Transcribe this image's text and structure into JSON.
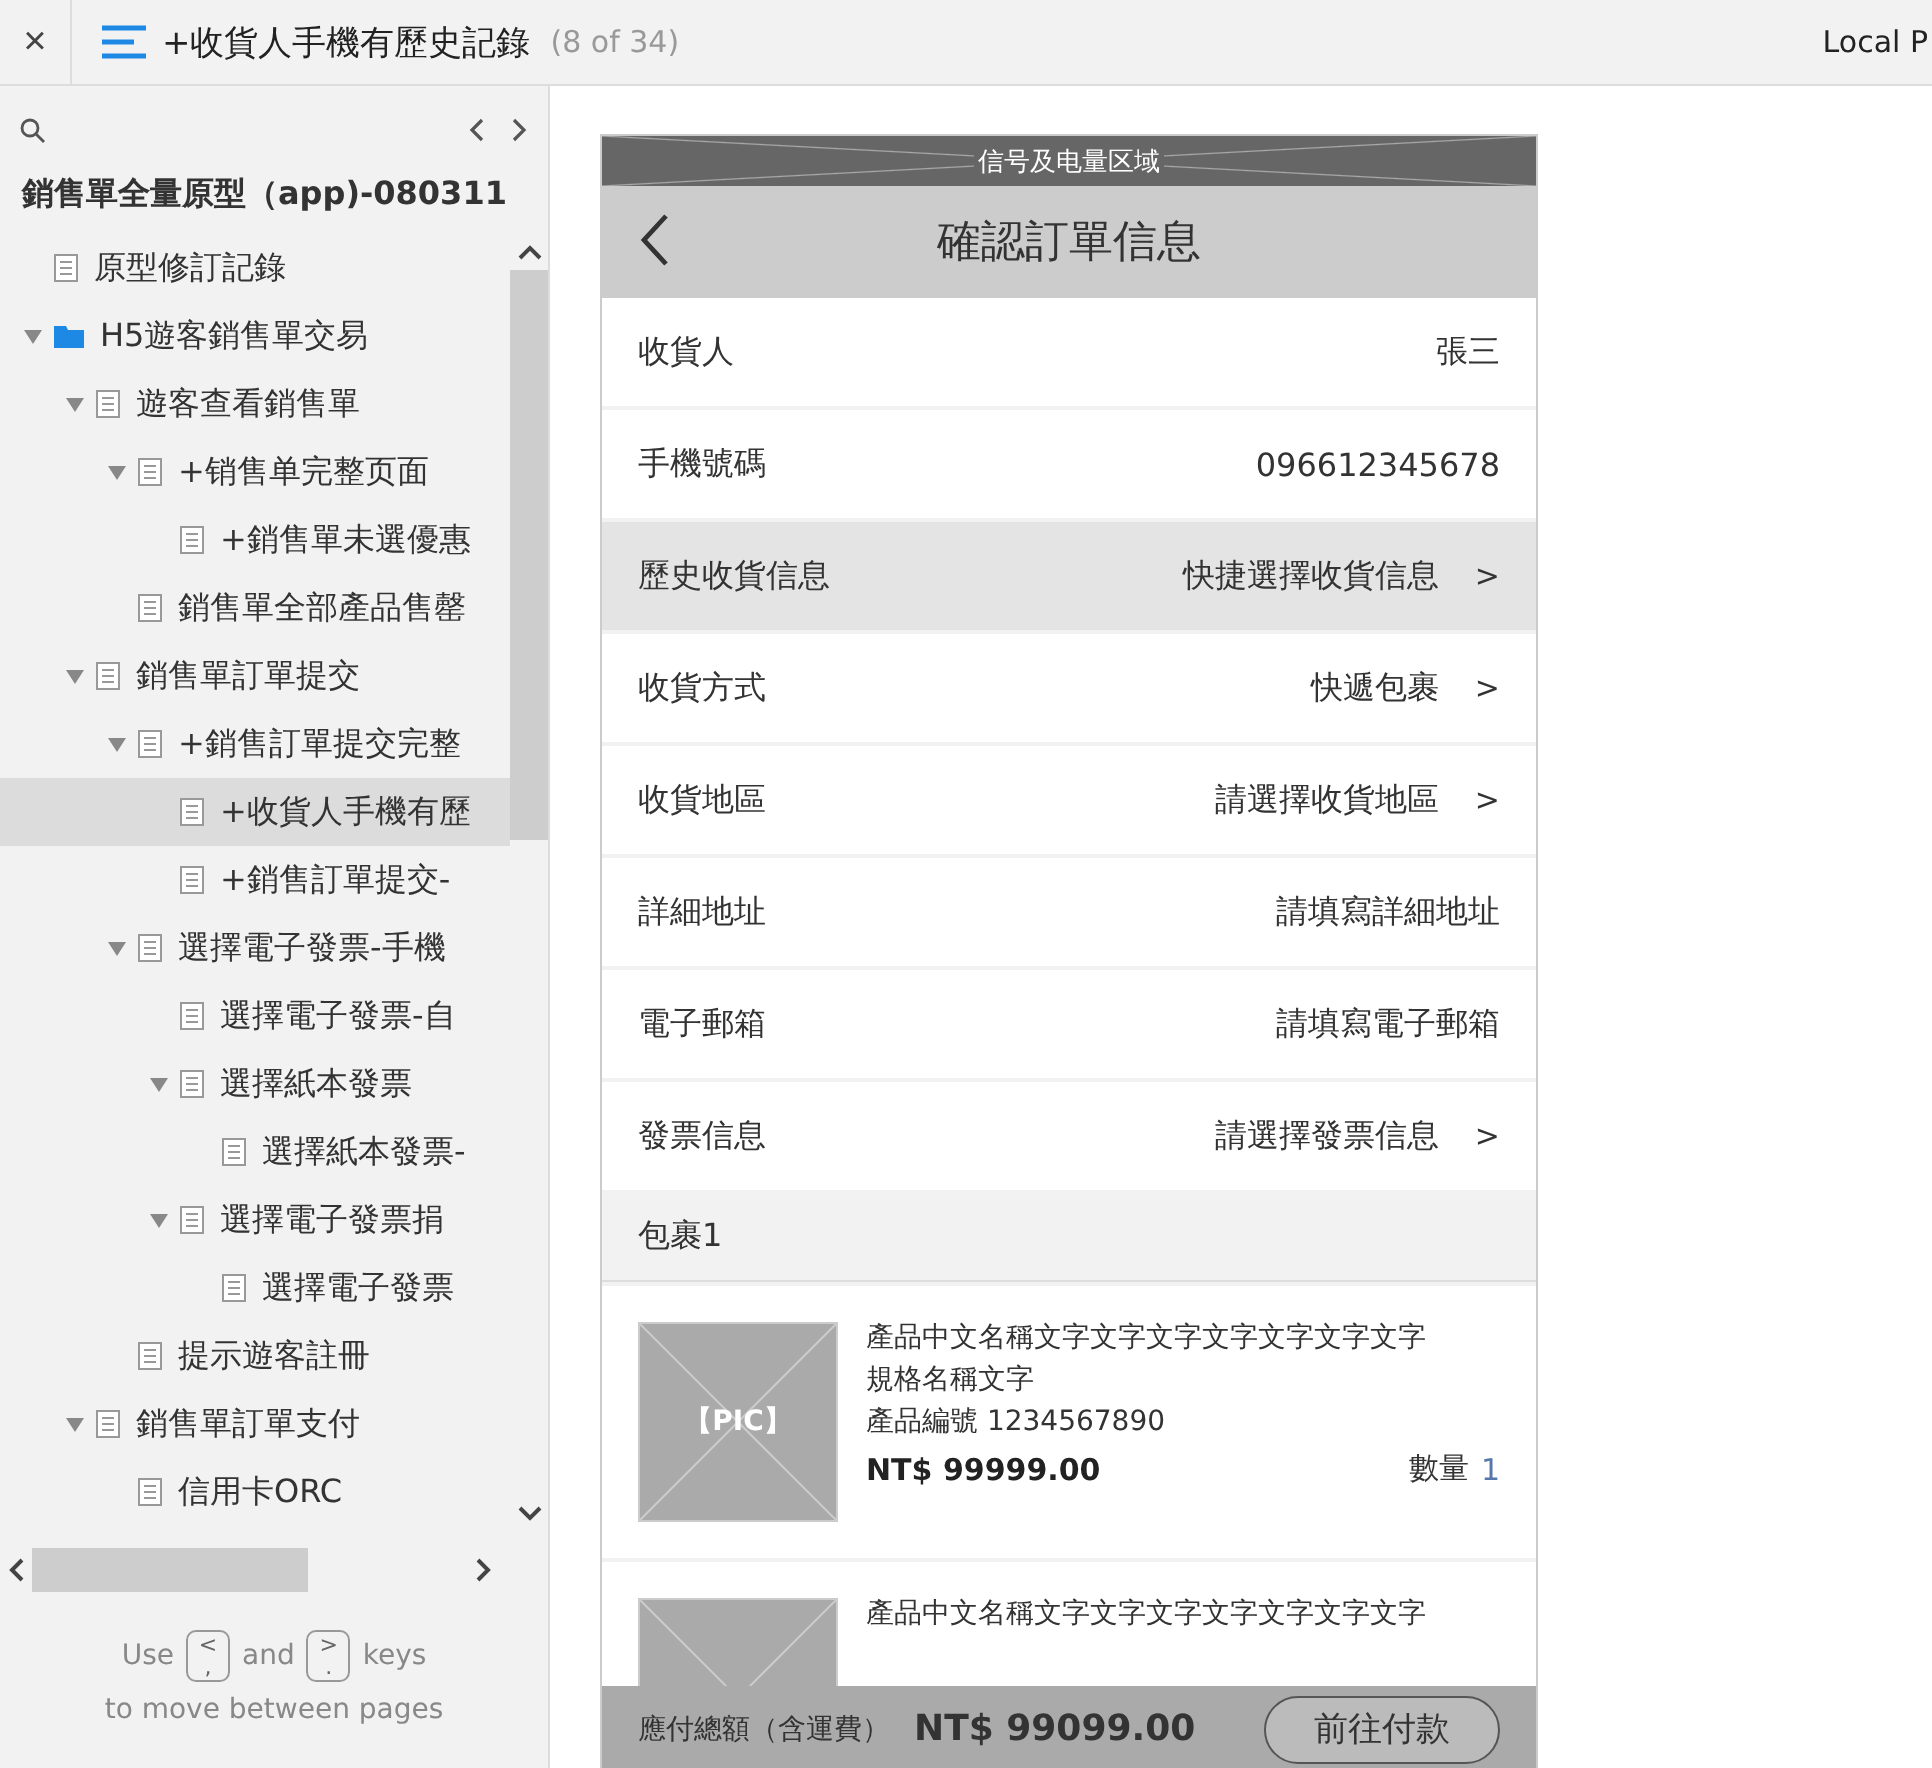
{
  "top_bar": {
    "close": "×",
    "title": "+收貨人手機有歷史記錄",
    "page_count": "(8 of 34)",
    "right_label": "Local P"
  },
  "sidebar": {
    "project_title": "銷售單全量原型（app)-080311",
    "tree": [
      {
        "label": "原型修訂記錄",
        "kind": "page",
        "selected": false
      },
      {
        "label": "H5遊客銷售單交易",
        "kind": "folder",
        "selected": false,
        "expanded": true,
        "children": [
          {
            "label": "遊客查看銷售單",
            "kind": "page",
            "selected": false,
            "expanded": true,
            "children": [
              {
                "label": "+销售单完整页面",
                "kind": "page",
                "selected": false,
                "expanded": true,
                "children": [
                  {
                    "label": "+銷售單未選優惠",
                    "kind": "page",
                    "selected": false
                  }
                ]
              },
              {
                "label": "銷售單全部產品售罄",
                "kind": "page",
                "selected": false
              }
            ]
          },
          {
            "label": "銷售單訂單提交",
            "kind": "page",
            "selected": false,
            "expanded": true,
            "children": [
              {
                "label": "+銷售訂單提交完整",
                "kind": "page",
                "selected": false,
                "expanded": true,
                "children": [
                  {
                    "label": "+收貨人手機有歷",
                    "kind": "page",
                    "selected": true
                  },
                  {
                    "label": "+銷售訂單提交-",
                    "kind": "page",
                    "selected": false
                  }
                ]
              },
              {
                "label": "選擇電子發票-手機",
                "kind": "page",
                "selected": false,
                "expanded": true,
                "children": [
                  {
                    "label": "選擇電子發票-自",
                    "kind": "page",
                    "selected": false
                  },
                  {
                    "label": "選擇紙本發票",
                    "kind": "page",
                    "selected": false,
                    "expanded": true,
                    "children": [
                      {
                        "label": "選擇紙本發票-",
                        "kind": "page",
                        "selected": false
                      }
                    ]
                  },
                  {
                    "label": "選擇電子發票捐",
                    "kind": "page",
                    "selected": false,
                    "expanded": true,
                    "children": [
                      {
                        "label": "選擇電子發票",
                        "kind": "page",
                        "selected": false
                      }
                    ]
                  }
                ]
              },
              {
                "label": "提示遊客註冊",
                "kind": "page",
                "selected": false
              }
            ]
          },
          {
            "label": "銷售單訂單支付",
            "kind": "page",
            "selected": false,
            "expanded": true,
            "children": [
              {
                "label": "信用卡ORC",
                "kind": "page",
                "selected": false
              }
            ]
          }
        ]
      }
    ],
    "hint": [
      {
        "kind": "text",
        "text": "Use"
      },
      {
        "kind": "key",
        "top": "<",
        "bottom": ","
      },
      {
        "kind": "text",
        "text": "and"
      },
      {
        "kind": "key",
        "top": ">",
        "bottom": "."
      },
      {
        "kind": "text",
        "text": "keys"
      }
    ],
    "hint_line2": "to move between pages"
  },
  "phone": {
    "status_bar": "信号及电量区域",
    "nav_title": "確認訂單信息",
    "rows": [
      {
        "label": "收貨人",
        "value": "張三",
        "chevron": false,
        "highlighted": false
      },
      {
        "label": "手機號碼",
        "value": "096612345678",
        "chevron": false,
        "highlighted": false
      },
      {
        "label": "歷史收貨信息",
        "value": "快捷選擇收貨信息",
        "chevron": true,
        "highlighted": true
      },
      {
        "label": "收貨方式",
        "value": "快遞包裹",
        "chevron": true,
        "highlighted": false
      },
      {
        "label": "收貨地區",
        "value": "請選擇收貨地區",
        "chevron": true,
        "highlighted": false
      },
      {
        "label": "詳細地址",
        "value": "請填寫詳細地址",
        "chevron": false,
        "highlighted": false
      },
      {
        "label": "電子郵箱",
        "value": "請填寫電子郵箱",
        "chevron": false,
        "highlighted": false
      },
      {
        "label": "發票信息",
        "value": "請選擇發票信息",
        "chevron": true,
        "highlighted": false
      }
    ],
    "chevron": ">",
    "package_title": "包裹1",
    "products": [
      {
        "pic_label": "【PIC】",
        "title": "產品中文名稱文字文字文字文字文字文字文字",
        "spec": "規格名稱文字",
        "code": "產品編號 1234567890",
        "price": "NT$ 99999.00",
        "qty_label": "數量",
        "qty_value": "1"
      },
      {
        "title": "產品中文名稱文字文字文字文字文字文字文字"
      }
    ],
    "footer": {
      "total_label": "應付總額（含運費）",
      "total": "NT$ 99099.00",
      "pay_button": "前往付款"
    }
  }
}
